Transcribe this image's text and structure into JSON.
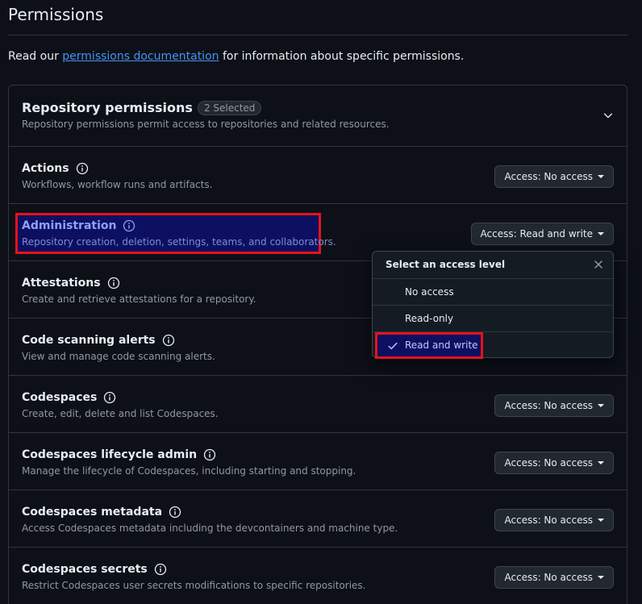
{
  "page": {
    "title": "Permissions",
    "intro_before": "Read our ",
    "intro_link": "permissions documentation",
    "intro_after": " for information about specific permissions."
  },
  "repo_permissions": {
    "title": "Repository permissions",
    "counter": "2 Selected",
    "description": "Repository permissions permit access to repositories and related resources."
  },
  "rows": [
    {
      "title": "Actions",
      "desc": "Workflows, workflow runs and artifacts.",
      "access": "Access: No access"
    },
    {
      "title": "Administration",
      "desc": "Repository creation, deletion, settings, teams, and collaborators.",
      "access": "Access: Read and write"
    },
    {
      "title": "Attestations",
      "desc": "Create and retrieve attestations for a repository.",
      "access": ""
    },
    {
      "title": "Code scanning alerts",
      "desc": "View and manage code scanning alerts.",
      "access": ""
    },
    {
      "title": "Codespaces",
      "desc": "Create, edit, delete and list Codespaces.",
      "access": "Access: No access"
    },
    {
      "title": "Codespaces lifecycle admin",
      "desc": "Manage the lifecycle of Codespaces, including starting and stopping.",
      "access": "Access: No access"
    },
    {
      "title": "Codespaces metadata",
      "desc": "Access Codespaces metadata including the devcontainers and machine type.",
      "access": "Access: No access"
    },
    {
      "title": "Codespaces secrets",
      "desc": "Restrict Codespaces user secrets modifications to specific repositories.",
      "access": "Access: No access"
    }
  ],
  "dropdown": {
    "header": "Select an access level",
    "options": [
      "No access",
      "Read-only",
      "Read and write"
    ],
    "selected": "Read and write"
  },
  "colors": {
    "background": "#0d1117",
    "link": "#4493f8",
    "highlight_border": "#e5121c",
    "highlight_fill": "#0d1060"
  }
}
